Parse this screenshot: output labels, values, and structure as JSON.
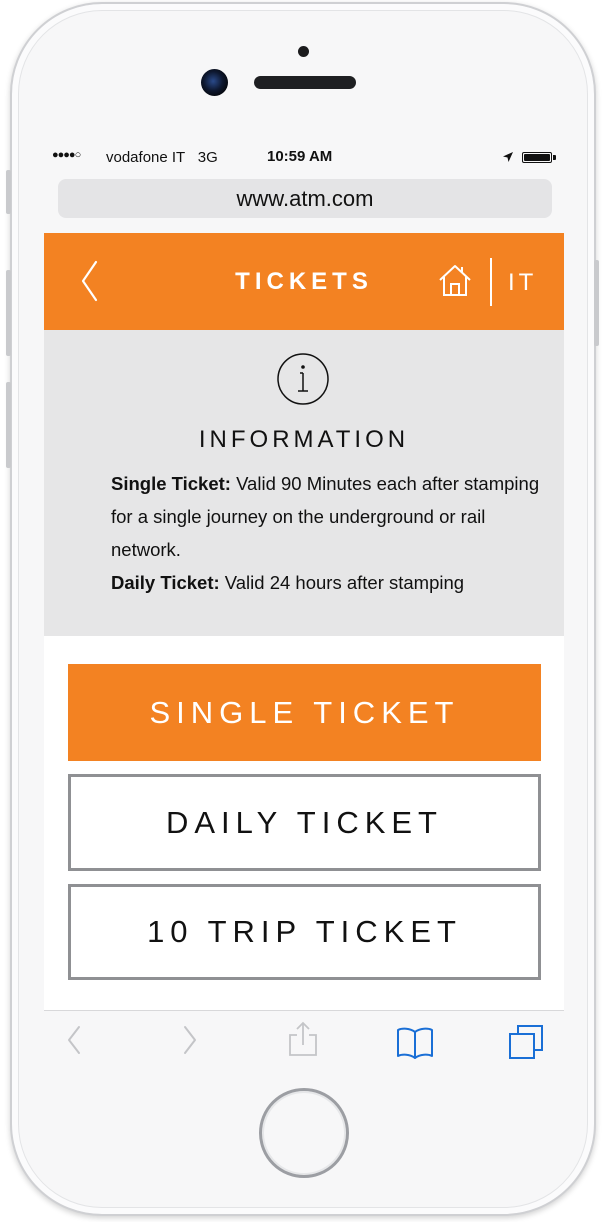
{
  "status_bar": {
    "signal": "●●●●○",
    "carrier": "vodafone IT",
    "network": "3G",
    "time": "10:59 AM",
    "location_icon": "location-arrow-icon",
    "battery_icon": "battery-icon",
    "battery_level": 1.0
  },
  "browser": {
    "url": "www.atm.com"
  },
  "header": {
    "title": "TICKETS",
    "back_icon": "chevron-left-icon",
    "home_icon": "home-icon",
    "language": "IT",
    "background_color": "#f38222"
  },
  "info": {
    "icon": "info-icon",
    "title": "INFORMATION",
    "single_label": "Single Ticket:",
    "single_text": "Valid 90 Minutes each after stamping for a single journey on the underground or rail network.",
    "daily_label": "Daily Ticket:",
    "daily_text": "Valid 24 hours after stamping"
  },
  "tickets": [
    {
      "label": "SINGLE TICKET",
      "selected": true
    },
    {
      "label": "DAILY TICKET",
      "selected": false
    },
    {
      "label": "10 TRIP TICKET",
      "selected": false
    }
  ],
  "toolbar": {
    "back_icon": "chevron-left-icon",
    "forward_icon": "chevron-right-icon",
    "share_icon": "share-icon",
    "bookmarks_icon": "book-icon",
    "tabs_icon": "tabs-icon",
    "accent_color": "#1a6fd6"
  },
  "colors": {
    "accent": "#f38222",
    "info_background": "#e6e6e7"
  }
}
